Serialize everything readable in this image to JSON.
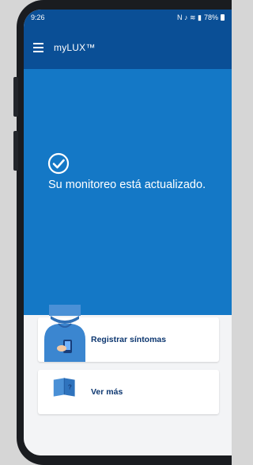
{
  "status_bar": {
    "time": "9:26",
    "icons": [
      "nfc-icon",
      "mute-icon",
      "wifi-icon",
      "signal-icon"
    ],
    "icon_glyphs": "N ♪ ≋ ▮",
    "battery": "78%"
  },
  "app_bar": {
    "title": "myLUX™"
  },
  "hero": {
    "message": "Su monitoreo está actualizado.",
    "bg_color": "#1478c6"
  },
  "cards": [
    {
      "label": "Registrar síntomas",
      "icon": "person-with-phone-illustration"
    },
    {
      "label": "Ver más",
      "icon": "book-question-illustration"
    }
  ],
  "colors": {
    "header": "#0a4f96",
    "hero": "#1478c6",
    "card_text": "#0d3770"
  }
}
